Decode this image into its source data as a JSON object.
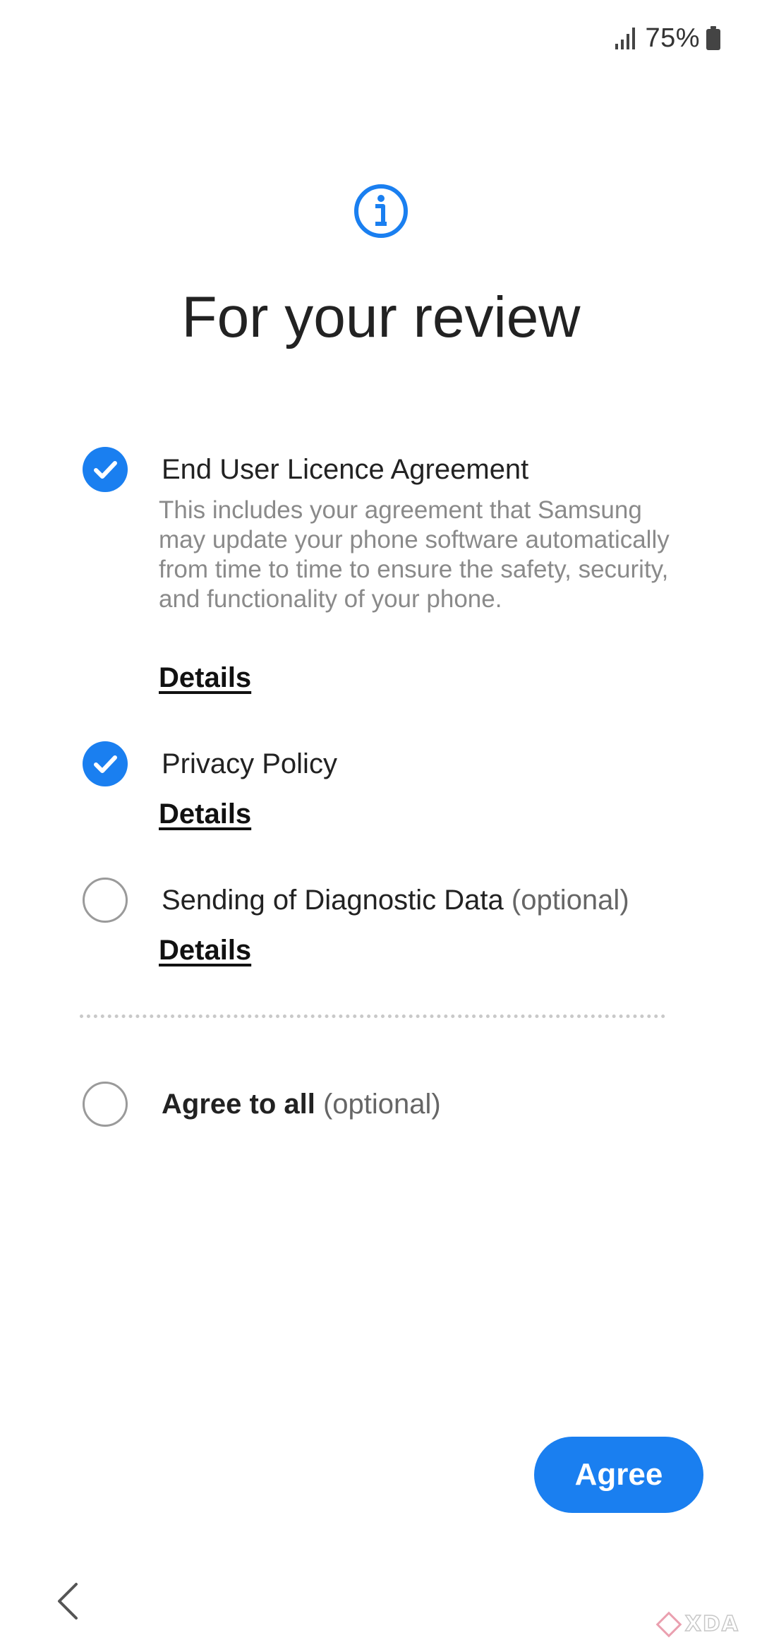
{
  "status_bar": {
    "battery_percent": "75%",
    "icons": [
      "signal-icon",
      "battery-icon"
    ]
  },
  "header": {
    "icon": "info-icon",
    "title": "For your review"
  },
  "agreements": [
    {
      "title": "End User Licence Agreement",
      "optional_suffix": "",
      "checked": true,
      "description": "This includes your agreement that Samsung may update your phone software automatically from time to time to ensure the safety, security, and functionality of your phone.",
      "details_label": "Details"
    },
    {
      "title": "Privacy Policy",
      "optional_suffix": "",
      "checked": true,
      "details_label": "Details"
    },
    {
      "title": "Sending of Diagnostic Data",
      "optional_suffix": "(optional)",
      "checked": false,
      "details_label": "Details"
    }
  ],
  "agree_all": {
    "title": "Agree to all",
    "optional_suffix": "(optional)",
    "checked": false
  },
  "agree_button": {
    "label": "Agree"
  },
  "navigation": {
    "back_icon": "chevron-left-icon"
  },
  "watermark": {
    "text": "XDA"
  },
  "colors": {
    "accent": "#1a7ff0",
    "text_primary": "#222222",
    "text_secondary": "#8a8a8a",
    "background": "#ffffff"
  }
}
